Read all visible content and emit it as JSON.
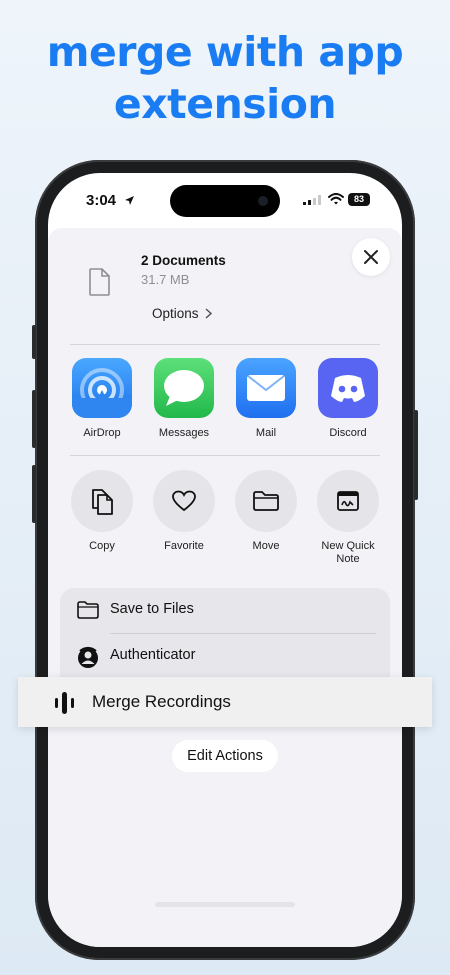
{
  "headline": {
    "line1": "merge with app",
    "line2": "extension"
  },
  "status_bar": {
    "time": "3:04",
    "battery": "83"
  },
  "share_sheet": {
    "item_title": "2 Documents",
    "item_size": "31.7 MB",
    "options_label": "Options",
    "apps": [
      {
        "label": "AirDrop",
        "icon": "airdrop-icon"
      },
      {
        "label": "Messages",
        "icon": "messages-icon"
      },
      {
        "label": "Mail",
        "icon": "mail-icon"
      },
      {
        "label": "Discord",
        "icon": "discord-icon"
      }
    ],
    "actions": [
      {
        "label": "Copy",
        "icon": "copy-icon"
      },
      {
        "label": "Favorite",
        "icon": "heart-icon"
      },
      {
        "label": "Move",
        "icon": "folder-icon"
      },
      {
        "label_line1": "New Quick",
        "label_line2": "Note",
        "icon": "quick-note-icon"
      }
    ],
    "list": [
      {
        "label": "Save to Files",
        "icon": "folder-icon"
      },
      {
        "label": "Authenticator",
        "icon": "authenticator-icon"
      }
    ],
    "highlight": {
      "label": "Merge Recordings",
      "icon": "waveform-icon"
    },
    "edit_actions_label": "Edit Actions"
  },
  "colors": {
    "headline": "#1a7cf2",
    "airdrop": "#2f8ff5",
    "messages": "#35c759",
    "mail": "#2f86f6",
    "discord": "#5865f2"
  }
}
